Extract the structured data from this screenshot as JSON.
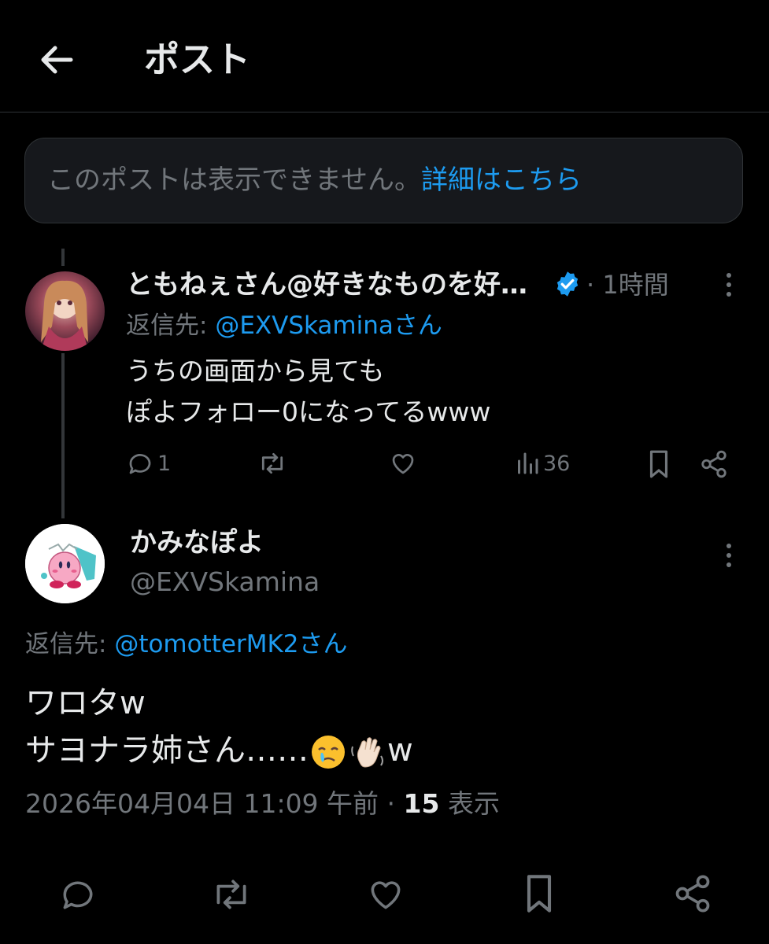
{
  "header": {
    "title": "ポスト"
  },
  "notice": {
    "text": "このポストは表示できません。",
    "link": "詳細はこちら"
  },
  "reply": {
    "display_name": "ともねぇさん@好きなものを好…",
    "time_separator": "·",
    "time": "1時間",
    "reply_to_prefix": "返信先:",
    "reply_to_handle": "@EXVSkaminaさん",
    "lines": [
      "うちの画面から見ても",
      "ぽよフォロー0になってるwww"
    ],
    "reply_count": "1",
    "views_count": "36"
  },
  "main": {
    "display_name": "かみなぽよ",
    "handle": "@EXVSkamina",
    "reply_to_prefix": "返信先:",
    "reply_to_handle": "@tomotterMK2さん",
    "line1": "ワロタw",
    "line2_text": "サヨナラ姉さん……",
    "line2_tail": "w",
    "timestamp": "2026年04月04日 11:09 午前",
    "separator": "·",
    "views": "15",
    "views_label": "表示"
  },
  "colors": {
    "accent": "#1d9bf0",
    "muted": "#71767b",
    "text": "#e7e9ea",
    "background": "#000000",
    "verified": "#1d9bf0"
  }
}
